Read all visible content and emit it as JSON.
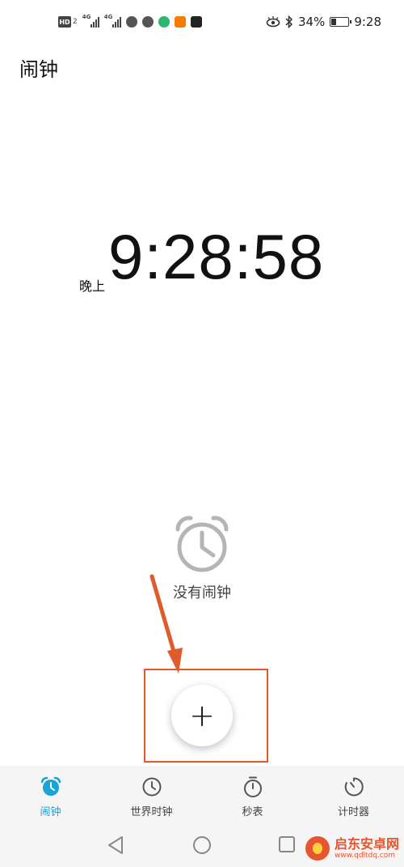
{
  "status_bar": {
    "hd_label": "HD",
    "hd_sub": "2",
    "signal1_tag": "4G",
    "signal2_tag": "4G",
    "battery_percent": "34%",
    "time": "9:28",
    "app_icon_colors": [
      "#555555",
      "#555555",
      "#2bb673",
      "#f57c00",
      "#222222"
    ]
  },
  "app": {
    "title": "闹钟"
  },
  "clock": {
    "period": "晚上",
    "time": "9:28:58"
  },
  "empty_state": {
    "text": "没有闹钟",
    "icon": "alarm-clock-icon"
  },
  "fab": {
    "label": "+",
    "icon": "plus-icon"
  },
  "annotation": {
    "color": "#e05a2b"
  },
  "bottom_nav": {
    "active_color": "#1aa3d9",
    "items": [
      {
        "label": "闹钟",
        "icon": "alarm-icon",
        "active": true
      },
      {
        "label": "世界时钟",
        "icon": "world-clock-icon",
        "active": false
      },
      {
        "label": "秒表",
        "icon": "stopwatch-icon",
        "active": false
      },
      {
        "label": "计时器",
        "icon": "timer-icon",
        "active": false
      }
    ]
  },
  "system_nav": {
    "back": "back-icon",
    "home": "home-icon",
    "recents": "recents-icon"
  },
  "watermark": {
    "name": "启东安卓网",
    "url": "www.qdltdq.com"
  }
}
